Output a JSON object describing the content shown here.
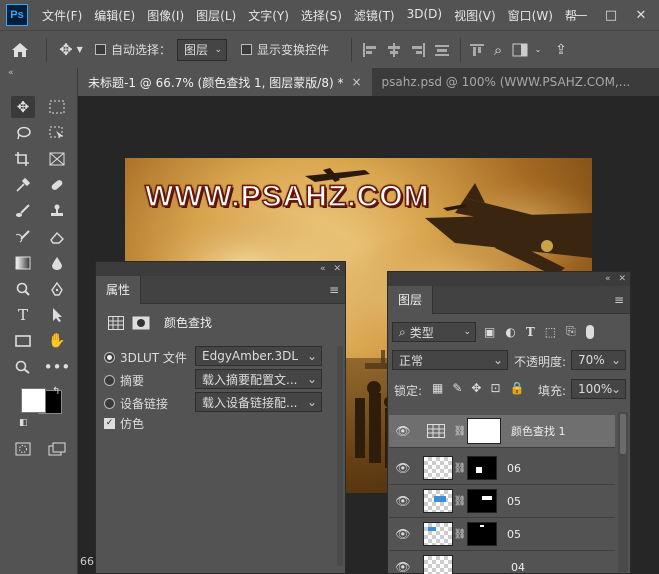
{
  "app": {
    "logo": "Ps"
  },
  "menu": [
    "文件(F)",
    "编辑(E)",
    "图像(I)",
    "图层(L)",
    "文字(Y)",
    "选择(S)",
    "滤镜(T)",
    "3D(D)",
    "视图(V)",
    "窗口(W)",
    "帮"
  ],
  "window_controls": {
    "minimize": "—",
    "maximize": "□",
    "close": "✕"
  },
  "options": {
    "auto_select_label": "自动选择：",
    "auto_select_target": "图层",
    "show_transform_label": "显示变换控件"
  },
  "tabs": [
    {
      "label": "未标题-1 @ 66.7% (颜色查找 1, 图层蒙版/8) *",
      "close": "×"
    },
    {
      "label": "psahz.psd @ 100% (WWW.PSAHZ.COM,..."
    }
  ],
  "artwork": {
    "headline": "WWW.PSAHZ.COM"
  },
  "status": {
    "zoom": "66"
  },
  "properties": {
    "title": "属性",
    "adjustment": "颜色查找",
    "options": [
      {
        "label": "3DLUT 文件",
        "value": "EdgyAmber.3DL",
        "selected": true
      },
      {
        "label": "摘要",
        "value": "载入摘要配置文...",
        "selected": false
      },
      {
        "label": "设备链接",
        "value": "载入设备链接配...",
        "selected": false
      }
    ],
    "dither_label": "仿色",
    "dither_checked": true
  },
  "layers": {
    "title": "图层",
    "filter_kind": "类型",
    "blend_mode": "正常",
    "opacity_label": "不透明度:",
    "opacity_value": "70%",
    "lock_label": "锁定:",
    "fill_label": "填充:",
    "fill_value": "100%",
    "items": [
      {
        "name": "颜色查找 1",
        "type": "adjustment",
        "selected": true
      },
      {
        "name": "06",
        "type": "masked"
      },
      {
        "name": "05",
        "type": "masked"
      },
      {
        "name": "05",
        "type": "masked"
      },
      {
        "name": "04",
        "type": "plain"
      }
    ]
  },
  "colors": {
    "foreground": "#ffffff",
    "background": "#000000",
    "accent": "#31a8ff"
  }
}
